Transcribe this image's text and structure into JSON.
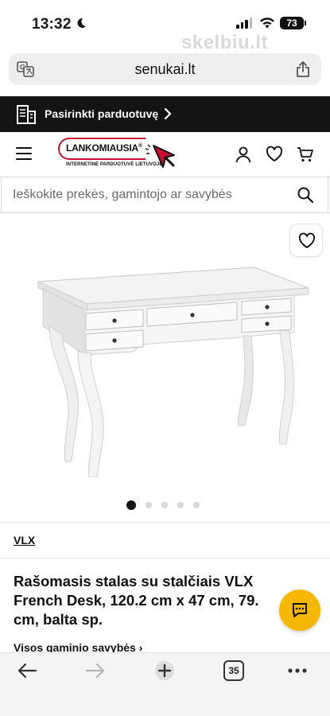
{
  "status_bar": {
    "time": "13:32",
    "battery": "73",
    "watermark": "skelbiu.lt"
  },
  "browser": {
    "url": "senukai.lt",
    "open_tabs": "35"
  },
  "store_banner": {
    "label": "Pasirinkti parduotuvę"
  },
  "header": {
    "logo_text": "LANKOMIAUSIA",
    "logo_mark": "®",
    "logo_subtitle": "INTERNETINĖ PARDUOTUVĖ LIETUVOJE"
  },
  "search": {
    "placeholder": "Ieškokite prekės, gamintojo ar savybės"
  },
  "gallery": {
    "image_count": 5,
    "active_index": 0
  },
  "product": {
    "brand": "VLX",
    "title": "Rašomasis stalas su stalčiais VLX French Desk, 120.2 cm x 47 cm, 79. cm, balta sp.",
    "spec_link": "Visos gaminio savybės ›"
  },
  "colors": {
    "banner_bg": "#141414",
    "accent_red": "#c8102e",
    "chat_yellow": "#f5b700"
  },
  "icons": [
    "moon-icon",
    "translate-icon",
    "share-icon",
    "store-icon",
    "chevron-right-icon",
    "menu-icon",
    "user-icon",
    "heart-icon",
    "cart-icon",
    "search-icon",
    "chat-icon",
    "back-arrow-icon",
    "forward-arrow-icon",
    "plus-icon",
    "more-icon"
  ]
}
